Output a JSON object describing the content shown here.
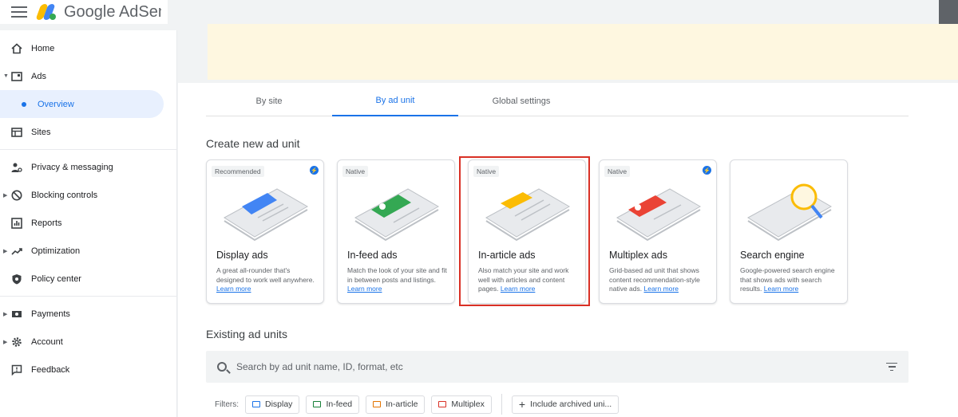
{
  "app": {
    "brand": "Google AdSense"
  },
  "sidebar": {
    "items": [
      {
        "label": "Home"
      },
      {
        "label": "Ads"
      },
      {
        "label": "Overview"
      },
      {
        "label": "Sites"
      },
      {
        "label": "Privacy & messaging"
      },
      {
        "label": "Blocking controls"
      },
      {
        "label": "Reports"
      },
      {
        "label": "Optimization"
      },
      {
        "label": "Policy center"
      },
      {
        "label": "Payments"
      },
      {
        "label": "Account"
      },
      {
        "label": "Feedback"
      }
    ]
  },
  "tabs": [
    {
      "label": "By site"
    },
    {
      "label": "By ad unit"
    },
    {
      "label": "Global settings"
    }
  ],
  "create_section": {
    "title": "Create new ad unit"
  },
  "cards": [
    {
      "tag": "Recommended",
      "title": "Display ads",
      "desc": "A great all-rounder that's designed to work well anywhere.",
      "link": "Learn more"
    },
    {
      "tag": "Native",
      "title": "In-feed ads",
      "desc": "Match the look of your site and fit in between posts and listings.",
      "link": "Learn more"
    },
    {
      "tag": "Native",
      "title": "In-article ads",
      "desc": "Also match your site and work well with articles and content pages.",
      "link": "Learn more"
    },
    {
      "tag": "Native",
      "title": "Multiplex ads",
      "desc": "Grid-based ad unit that shows content recommendation-style native ads.",
      "link": "Learn more"
    },
    {
      "tag": "",
      "title": "Search engine",
      "desc": "Google-powered search engine that shows ads with search results.",
      "link": "Learn more"
    }
  ],
  "existing_section": {
    "title": "Existing ad units"
  },
  "search": {
    "placeholder": "Search by ad unit name, ID, format, etc"
  },
  "filters": {
    "label": "Filters:",
    "chips": [
      {
        "label": "Display",
        "color": "#1a73e8"
      },
      {
        "label": "In-feed",
        "color": "#188038"
      },
      {
        "label": "In-article",
        "color": "#e37400"
      },
      {
        "label": "Multiplex",
        "color": "#d93025"
      }
    ],
    "archived": "Include archived uni..."
  },
  "colors": {
    "accent": "#1a73e8",
    "highlight": "#d93025",
    "notice": "#fef7e0"
  }
}
